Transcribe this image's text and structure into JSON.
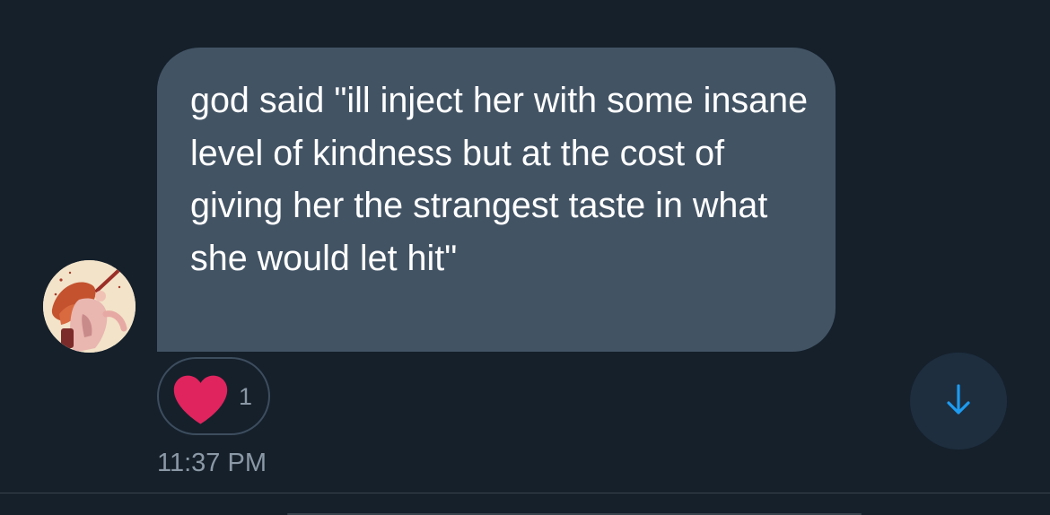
{
  "message": {
    "text": "god said \"ill inject her with some insane level of kindness but at the cost of giving her the strangest taste in what she would let hit\"",
    "time": "11:37 PM"
  },
  "reaction": {
    "icon": "heart-icon",
    "count": "1",
    "color": "#e0245e"
  },
  "avatar": {
    "icon": "user-avatar"
  },
  "scroll": {
    "icon": "arrow-down-icon",
    "color": "#1d9bf0"
  },
  "colors": {
    "background": "#15202b",
    "bubble": "#425364",
    "muted_text": "#8b98a5"
  }
}
